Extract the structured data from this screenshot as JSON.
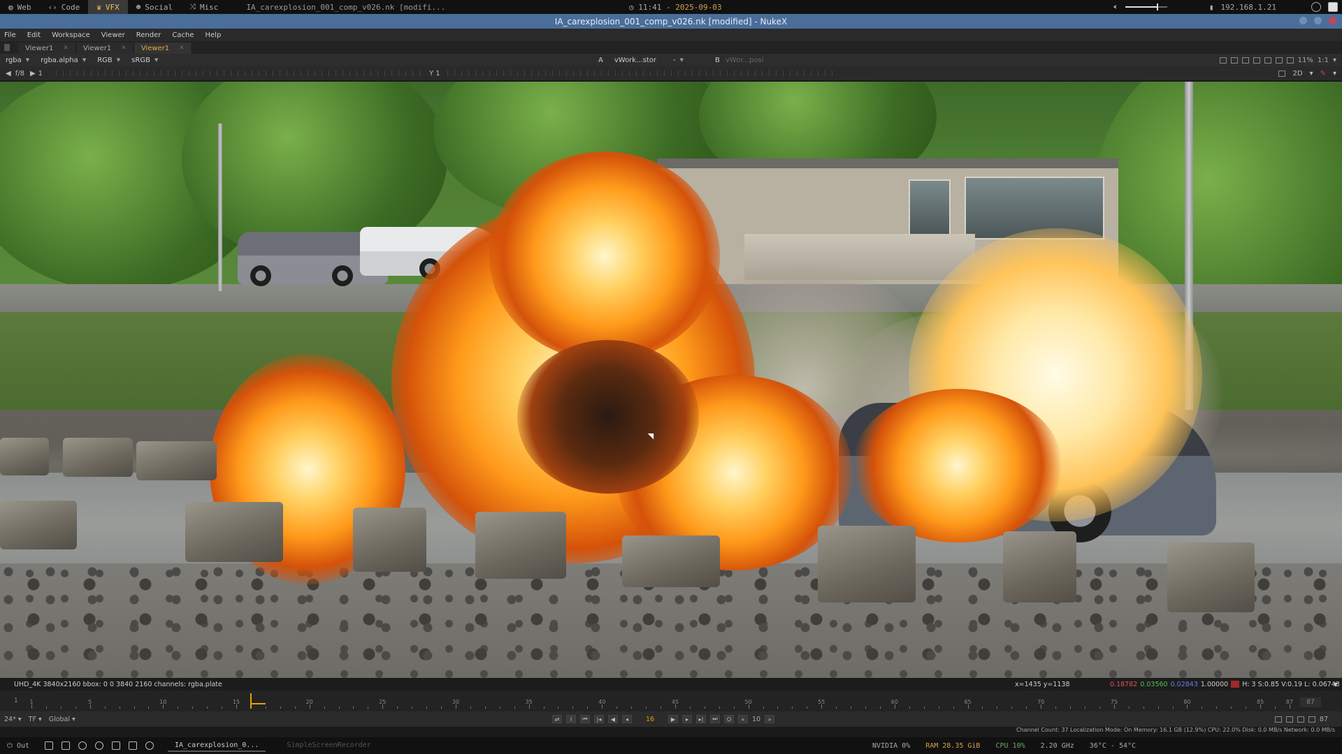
{
  "system_bar": {
    "workspaces": [
      {
        "label": "Web",
        "icon": "globe-icon",
        "active": false
      },
      {
        "label": "Code",
        "icon": "code-icon",
        "active": false
      },
      {
        "label": "VFX",
        "icon": "vfx-icon",
        "active": true
      },
      {
        "label": "Social",
        "icon": "social-icon",
        "active": false
      },
      {
        "label": "Misc",
        "icon": "shuffle-icon",
        "active": false
      }
    ],
    "window_title": "IA_carexplosion_001_comp_v026.nk [modifi...",
    "time": "11:41",
    "date": "2025-09-03",
    "volume_level": 0.75,
    "ip": "192.168.1.21"
  },
  "app": {
    "title": "IA_carexplosion_001_comp_v026.nk [modified] - NukeX",
    "accent": "#4a6e9a"
  },
  "menu": [
    "File",
    "Edit",
    "Workspace",
    "Viewer",
    "Render",
    "Cache",
    "Help"
  ],
  "viewer_tabs": [
    {
      "label": "Viewer1",
      "active": false
    },
    {
      "label": "Viewer1",
      "active": false
    },
    {
      "label": "Viewer1",
      "active": true
    }
  ],
  "viewer_toolbar": {
    "channels": "rgba",
    "alpha": "rgba.alpha",
    "display": "RGB",
    "colorspace": "sRGB",
    "a_label": "A",
    "a_input": "vWork...stor",
    "a_op": "-",
    "b_label": "B",
    "b_input": "vWor...posi",
    "zoom": "1:1",
    "zoom_pct": "11%",
    "proxy_label": "f/8",
    "frame_left": "1",
    "y_label": "Y",
    "y_value": "1",
    "view_mode": "2D"
  },
  "info_bar": {
    "format": "UHD_4K 3840x2160  bbox: 0 0 3840 2160  channels: rgba.plate",
    "coords": "x=1435 y=1138",
    "pixel_r": "0.18782",
    "pixel_g": "0.03560",
    "pixel_b": "0.02843",
    "pixel_a": "1.00000",
    "hsv": "H: 3 S:0.85 V:0.19  L: 0.06743",
    "swatch_color": "#a02828"
  },
  "timeline": {
    "start": "1",
    "end": "87",
    "current_frame": "16",
    "tick_labels": [
      "1",
      "5",
      "10",
      "15",
      "20",
      "25",
      "30",
      "35",
      "40",
      "45",
      "50",
      "55",
      "60",
      "65",
      "70",
      "75",
      "80",
      "85",
      "87"
    ]
  },
  "transport": {
    "fps": "24*",
    "tf": "TF",
    "scope": "Global",
    "increment": "10",
    "end_frame": "87"
  },
  "status_line": "Channel Count: 37  Localization Mode: On  Memory: 16.1 GB (12.9%)  CPU: 22.0%  Disk: 0.0 MB/s  Network: 0.0 MB/s",
  "taskbar": {
    "out_label": "Out",
    "active_task": "IA_carexplosion_0...",
    "inactive_task": "SimpleScreenRecorder",
    "gpu": "NVIDIA 0%",
    "ram": "RAM 28.35 GiB",
    "cpu": "CPU 10%",
    "freq": "2.20 GHz",
    "temp": "36°C - 54°C"
  }
}
